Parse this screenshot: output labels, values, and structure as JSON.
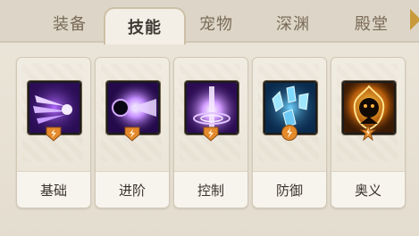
{
  "tabs": [
    {
      "label": "装备"
    },
    {
      "label": "技能",
      "active": true
    },
    {
      "label": "宠物"
    },
    {
      "label": "深渊"
    },
    {
      "label": "殿堂"
    }
  ],
  "skills": [
    {
      "label": "基础",
      "icon": "purple-claw-slash-icon"
    },
    {
      "label": "进阶",
      "icon": "purple-energy-burst-icon"
    },
    {
      "label": "控制",
      "icon": "purple-vortex-icon"
    },
    {
      "label": "防御",
      "icon": "blue-crystal-shield-icon"
    },
    {
      "label": "奥义",
      "icon": "golden-dark-flame-icon"
    }
  ],
  "colors": {
    "badge_orange": "#e58a2c",
    "accent_gold": "#c99a3c"
  }
}
